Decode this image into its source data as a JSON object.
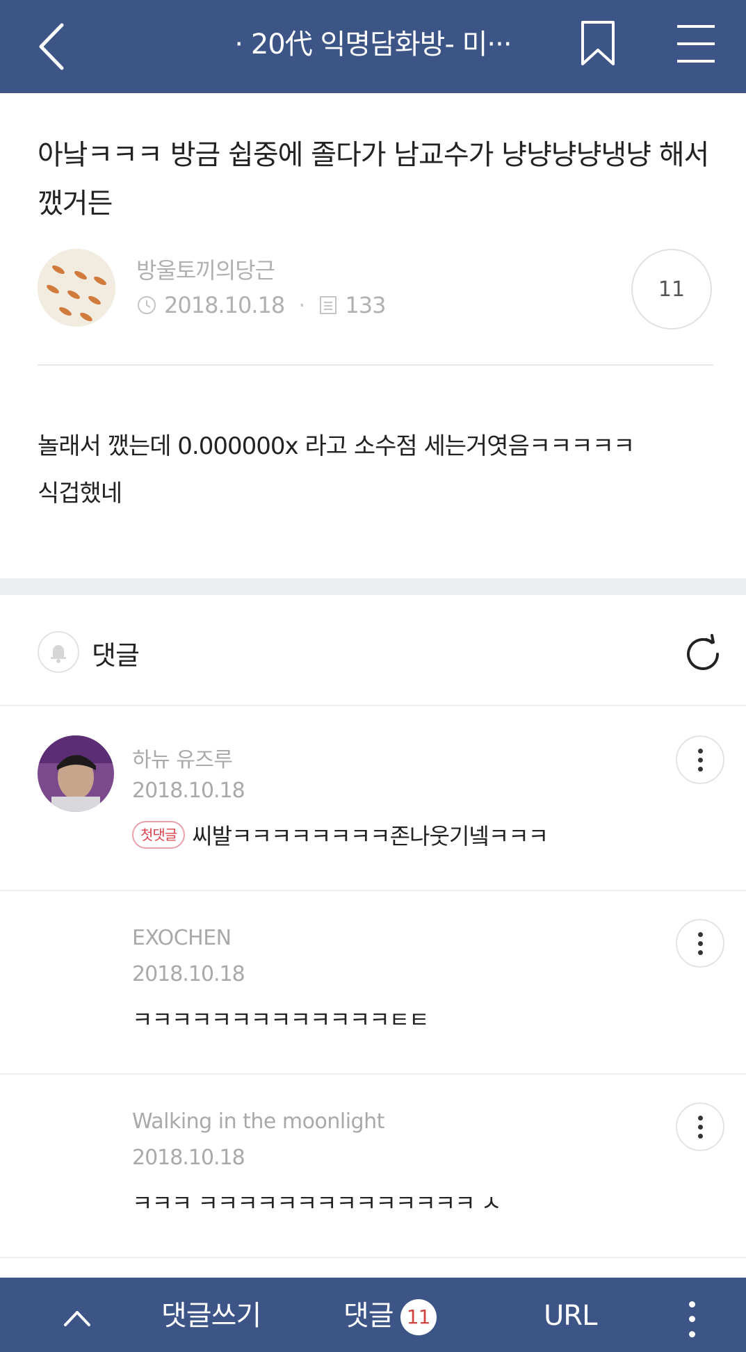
{
  "header": {
    "title": "· 20代 익명담화방- 미···",
    "back_icon": "chevron-left-icon",
    "bookmark_icon": "bookmark-icon",
    "menu_icon": "hamburger-menu-icon"
  },
  "post": {
    "title": "아낰ㅋㅋㅋ 방금 쉽중에 졸다가 남교수가 냥냥냥냥냉냥 해서 깼거든",
    "author": "방울토끼의당근",
    "date": "2018.10.18",
    "views": "133",
    "comment_count": "11",
    "body_line1": "놀래서 깼는데 0.000000x 라고 소수점 세는거엿음ㅋㅋㅋㅋㅋ",
    "body_line2": "식겁했네"
  },
  "comments_section": {
    "label": "댓글"
  },
  "comments": [
    {
      "author": "하뉴 유즈루",
      "date": "2018.10.18",
      "badge": "첫댓글",
      "text": "씨발ㅋㅋㅋㅋㅋㅋㅋㅋ존나웃기넼ㅋㅋㅋ"
    },
    {
      "author": "EXOCHEN",
      "date": "2018.10.18",
      "text": "ㅋㅋㅋㅋㅋㅋㅋㅋㅋㅋㅋㅋㅋㅌㅌ"
    },
    {
      "author": "Walking in the moonlight",
      "date": "2018.10.18",
      "text": "ㅋㅋㅋ ㅋㅋㅋㅋㅋㅋㅋㅋㅋㅋㅋㅋㅋㅋ ㅅ"
    }
  ],
  "bottom_bar": {
    "up_icon": "chevron-up-icon",
    "write_label": "댓글쓰기",
    "comments_label": "댓글",
    "comments_badge": "11",
    "url_label": "URL",
    "more_icon": "more-vertical-icon"
  },
  "colors": {
    "nav_bg": "#3d5487",
    "badge_red": "#d9434f"
  }
}
